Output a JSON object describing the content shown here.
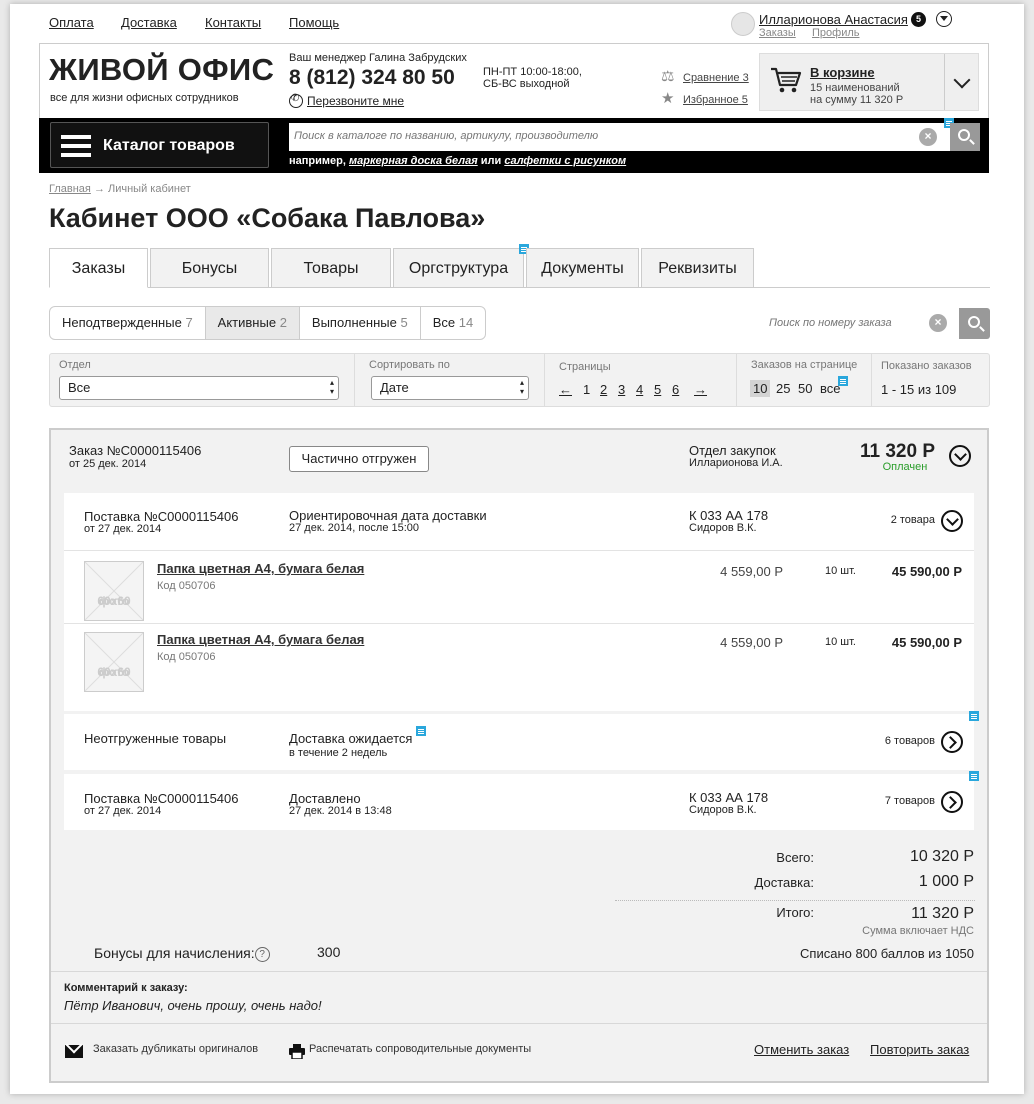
{
  "topnav": {
    "items": [
      "Оплата",
      "Доставка",
      "Контакты",
      "Помощь"
    ]
  },
  "user": {
    "name": "Илларионова Анастасия",
    "badge": "5",
    "links": [
      "Заказы",
      "Профиль"
    ]
  },
  "header": {
    "logo": "ЖИВОЙ ОФИС",
    "slogan": "все для жизни офисных сотрудников",
    "manager": "Ваш менеджер Галина Забрудских",
    "phone": "8 (812) 324 80 50",
    "hours": [
      "ПН-ПТ 10:00-18:00,",
      "СБ-ВС выходной"
    ],
    "callback": "Перезвоните мне",
    "compare": "Сравнение 3",
    "favorites": "Избранное 5"
  },
  "cart": {
    "title": "В корзине",
    "line1": "15 наименований",
    "line2": "на сумму 11 320 Р"
  },
  "catalog": {
    "label": "Каталог товаров"
  },
  "search": {
    "placeholder": "Поиск в каталоге по названию, артикулу, производителю",
    "example_prefix": "например,",
    "example1": "маркерная доска белая",
    "example_or": "или",
    "example2": "салфетки с рисунком"
  },
  "breadcrumbs": {
    "home": "Главная",
    "arrow": "→",
    "current": "Личный кабинет"
  },
  "page_title": "Кабинет ООО «Собака Павлова»",
  "tabs": [
    "Заказы",
    "Бонусы",
    "Товары",
    "Оргструктура",
    "Документы",
    "Реквизиты"
  ],
  "filters": {
    "segments": [
      {
        "label": "Неподтвержденные",
        "count": "7"
      },
      {
        "label": "Активные",
        "count": "2"
      },
      {
        "label": "Выполненные",
        "count": "5"
      },
      {
        "label": "Все",
        "count": "14"
      }
    ],
    "order_search_placeholder": "Поиск по номеру заказа",
    "dept_label": "Отдел",
    "dept_value": "Все",
    "sort_label": "Сортировать по",
    "sort_value": "Дате",
    "pages_label": "Страницы",
    "pages": [
      "1",
      "2",
      "3",
      "4",
      "5",
      "6"
    ],
    "prev": "←",
    "next": "→",
    "per_page_label": "Заказов на странице",
    "per_page": [
      "10",
      "25",
      "50",
      "все"
    ],
    "shown_label": "Показано заказов",
    "shown_value": "1 - 15 из 109"
  },
  "order": {
    "number": "Заказ №С0000115406",
    "date": "от 25 дек. 2014",
    "status": "Частично отгружен",
    "dept": "Отдел закупок",
    "person": "Илларионова И.А.",
    "total": "11 320 Р",
    "paid": "Оплачен",
    "deliveries": [
      {
        "title": "Поставка №С0000115406",
        "date": "от 27 дек. 2014",
        "info": "Ориентировочная дата доставки",
        "info_sub": "27 дек. 2014, после 15:00",
        "car": "К 033 АА 178",
        "driver": "Сидоров В.К.",
        "count": "2 товара"
      },
      {
        "title": "Неотгруженные товары",
        "info": "Доставка ожидается",
        "info_sub": "в течение 2 недель",
        "count": "6 товаров"
      },
      {
        "title": "Поставка №С0000115406",
        "date": "от 27 дек. 2014",
        "info": "Доставлено",
        "info_sub": "27 дек. 2014 в 13:48",
        "car": "К 033 АА 178",
        "driver": "Сидоров В.К.",
        "count": "7 товаров"
      }
    ],
    "items": [
      {
        "name": "Папка цветная А4, бумага белая",
        "code": "Код 050706",
        "price": "4 559,00 Р",
        "qty": "10 шт.",
        "sum": "45 590,00 Р",
        "photo": [
          "фото",
          "60x60"
        ]
      },
      {
        "name": "Папка цветная А4, бумага белая",
        "code": "Код 050706",
        "price": "4 559,00 Р",
        "qty": "10 шт.",
        "sum": "45 590,00 Р",
        "photo": [
          "фото",
          "60x60"
        ]
      }
    ],
    "totals": {
      "subtotal_label": "Всего:",
      "subtotal": "10 320 Р",
      "delivery_label": "Доставка:",
      "delivery": "1 000 Р",
      "grand_label": "Итого:",
      "grand": "11 320 Р",
      "vat_note": "Сумма включает НДС"
    },
    "bonus_label": "Бонусы для начисления:",
    "bonus_hint": "?",
    "bonus_value": "300",
    "written_off": "Списано 800 баллов из 1050",
    "comment_label": "Комментарий к заказу:",
    "comment": "Пётр Иванович, очень прошу, очень надо!",
    "actions": {
      "duplicates": "Заказать дубликаты оригиналов",
      "print": "Распечатать сопроводительные документы",
      "cancel": "Отменить заказ",
      "repeat": "Повторить заказ"
    }
  }
}
